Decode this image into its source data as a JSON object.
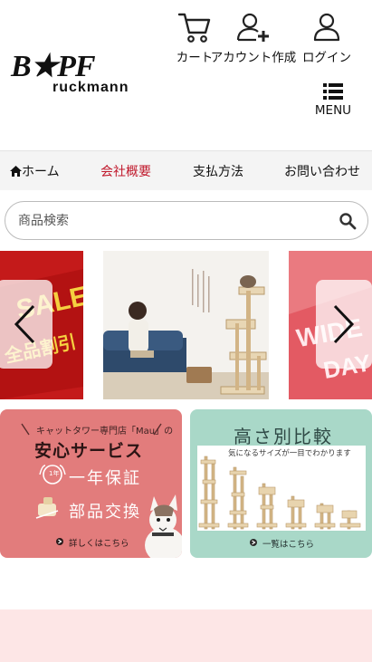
{
  "brand": {
    "logo_top": "B★PF",
    "logo_bottom": "ruckmann"
  },
  "header": {
    "cart_label": "カート",
    "account_label": "アカウント作成",
    "login_label": "ログイン",
    "menu_label": "MENU"
  },
  "nav": {
    "items": [
      {
        "label": "ホーム",
        "icon": "home-icon"
      },
      {
        "label": "会社概要",
        "active": true
      },
      {
        "label": "支払方法"
      },
      {
        "label": "お問い合わせ"
      }
    ],
    "active_color": "#c0182b"
  },
  "search": {
    "placeholder": "商品検索",
    "value": ""
  },
  "carousel": {
    "left_slide_text": [
      "SALE",
      "全品割引"
    ],
    "right_slide_text": [
      "WIDE",
      "DAY"
    ]
  },
  "banners": {
    "service": {
      "shop_caption": "キャットタワー専門店「Mau」の",
      "title": "安心サービス",
      "warranty_badge": "1年",
      "warranty": "一年保証",
      "parts": "部品交換",
      "link": "詳しくはこちら"
    },
    "compare": {
      "title": "高さ別比較",
      "subtitle": "気になるサイズが一目でわかります",
      "link": "一覧はこちら"
    }
  },
  "colors": {
    "accent_red": "#c0182b",
    "service_banner": "#e27c7c",
    "compare_banner": "#a9d8c8",
    "footer_band": "#fde6e6"
  }
}
